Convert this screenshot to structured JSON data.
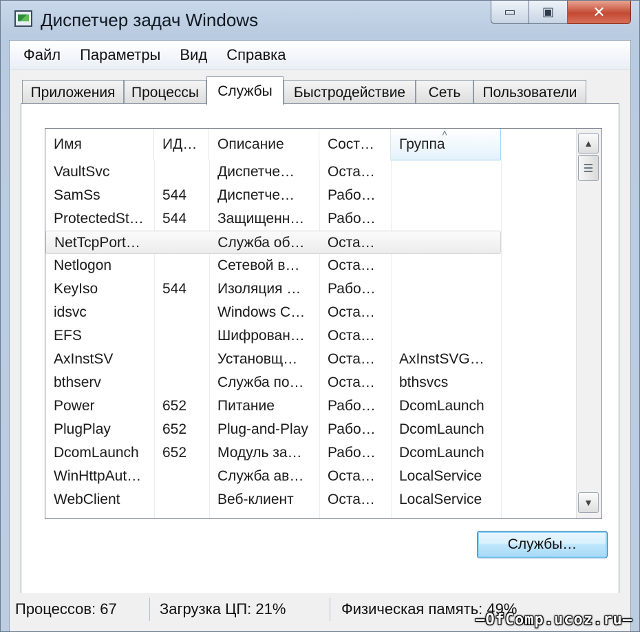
{
  "window": {
    "title": "Диспетчер задач Windows",
    "minimize_glyph": "▭",
    "maximize_glyph": "▣",
    "close_glyph": "✕"
  },
  "menu": [
    "Файл",
    "Параметры",
    "Вид",
    "Справка"
  ],
  "tabs": [
    {
      "label": "Приложения",
      "selected": false
    },
    {
      "label": "Процессы",
      "selected": false
    },
    {
      "label": "Службы",
      "selected": true
    },
    {
      "label": "Быстродействие",
      "selected": false
    },
    {
      "label": "Сеть",
      "selected": false
    },
    {
      "label": "Пользователи",
      "selected": false
    }
  ],
  "services": {
    "columns": [
      "Имя",
      "ИД…",
      "Описание",
      "Сост…",
      "Группа"
    ],
    "sorted_column": "Группа",
    "sort_arrow": "˄",
    "highlighted_row": "NetTcpPort…",
    "rows": [
      [
        "VaultSvc",
        "",
        "Диспетче…",
        "Оста…",
        ""
      ],
      [
        "SamSs",
        "544",
        "Диспетче…",
        "Рабо…",
        ""
      ],
      [
        "ProtectedSt…",
        "544",
        "Защищенн…",
        "Рабо…",
        ""
      ],
      [
        "NetTcpPort…",
        "",
        "Служба об…",
        "Оста…",
        ""
      ],
      [
        "Netlogon",
        "",
        "Сетевой в…",
        "Оста…",
        ""
      ],
      [
        "KeyIso",
        "544",
        "Изоляция …",
        "Рабо…",
        ""
      ],
      [
        "idsvc",
        "",
        "Windows C…",
        "Оста…",
        ""
      ],
      [
        "EFS",
        "",
        "Шифрован…",
        "Оста…",
        ""
      ],
      [
        "AxInstSV",
        "",
        "Установщ…",
        "Оста…",
        "AxInstSVG…"
      ],
      [
        "bthserv",
        "",
        "Служба по…",
        "Оста…",
        "bthsvcs"
      ],
      [
        "Power",
        "652",
        "Питание",
        "Рабо…",
        "DcomLaunch"
      ],
      [
        "PlugPlay",
        "652",
        "Plug-and-Play",
        "Рабо…",
        "DcomLaunch"
      ],
      [
        "DcomLaunch",
        "652",
        "Модуль за…",
        "Рабо…",
        "DcomLaunch"
      ],
      [
        "WinHttpAut…",
        "",
        "Служба ав…",
        "Оста…",
        "LocalService"
      ],
      [
        "WebClient",
        "",
        "Веб-клиент",
        "Оста…",
        "LocalService"
      ]
    ],
    "scroll_up_glyph": "▲",
    "scroll_down_glyph": "▼",
    "button_label": "Службы…"
  },
  "status": {
    "processes": "Процессов: 67",
    "cpu": "Загрузка ЦП: 21%",
    "memory": "Физическая память: 49%"
  },
  "watermark": "—OfComp.ucoz.ru—"
}
